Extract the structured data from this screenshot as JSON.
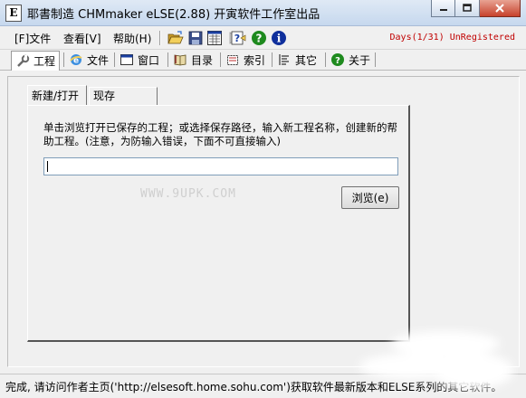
{
  "window": {
    "icon_letter": "E",
    "title": "耶書制造 CHMmaker eLSE(2.88) 开寅软件工作室出品"
  },
  "menu": {
    "items": [
      "[F]文件",
      "查看[V]",
      "帮助(H)"
    ],
    "registration": "Days(1/31) UnRegistered"
  },
  "tabs": [
    "工程",
    "文件",
    "窗口",
    "目录",
    "索引",
    "其它",
    "关于"
  ],
  "subtabs": [
    "新建/打开",
    "现存"
  ],
  "panel": {
    "description": "单击浏览打开已保存的工程；或选择保存路径，输入新工程名称，创建新的帮助工程。(注意，为防输入错误，下面不可直接输入)",
    "path_value": "",
    "watermark": "WWW.9UPK.COM",
    "browse_label": "浏览(e)"
  },
  "status": {
    "text": "完成, 请访问作者主页('http://elsesoft.home.sohu.com')获取软件最新版本和ELSE系列的其它软件。"
  },
  "colors": {
    "registration_red": "#c00000",
    "help_green": "#1e8a1e"
  }
}
